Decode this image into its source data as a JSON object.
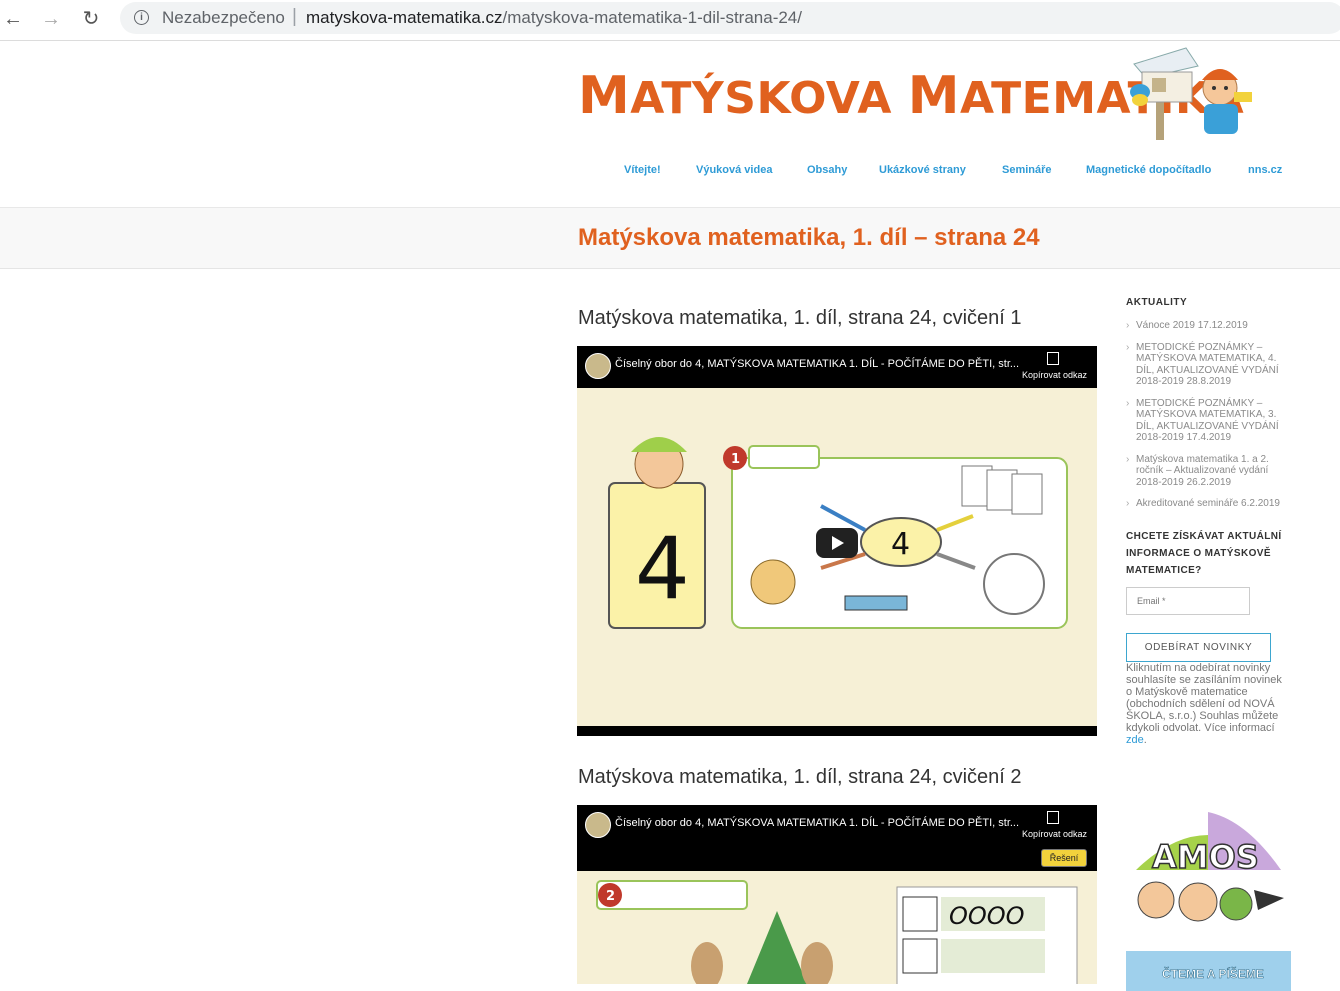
{
  "browser": {
    "insecure_label": "Nezabezpečeno",
    "url_host": "matyskova-matematika.cz",
    "url_path": "/matyskova-matematika-1-dil-strana-24/"
  },
  "site": {
    "logo_text_1_big": "M",
    "logo_text_1_rest": "ATÝSKOVA",
    "logo_text_2_big": "M",
    "logo_text_2_rest": "ATEMATIKA",
    "accent_color": "#e0611f",
    "link_color": "#2e9bd6"
  },
  "nav": {
    "items": [
      {
        "label": "Vítejte!"
      },
      {
        "label": "Výuková videa"
      },
      {
        "label": "Obsahy"
      },
      {
        "label": "Ukázkové strany"
      },
      {
        "label": "Semináře"
      },
      {
        "label": "Magnetické dopočítadlo"
      },
      {
        "label": "nns.cz"
      }
    ]
  },
  "page": {
    "title": "Matýskova matematika, 1. díl – strana 24"
  },
  "exercises": [
    {
      "heading": "Matýskova matematika, 1. díl, strana 24, cvičení 1",
      "video_title": "Číselný obor do 4, MATÝSKOVA MATEMATIKA 1. DÍL - POČÍTÁME DO PĚTI, str...",
      "copy_label": "Kopírovat odkaz",
      "big_number": "4",
      "badge": "1",
      "center_number": "4"
    },
    {
      "heading": "Matýskova matematika, 1. díl, strana 24, cvičení 2",
      "video_title": "Číselný obor do 4, MATÝSKOVA MATEMATIKA 1. DÍL - POČÍTÁME DO PĚTI, str...",
      "copy_label": "Kopírovat odkaz",
      "solution_label": "Řešení",
      "badge": "2",
      "writing": "OOOO"
    }
  ],
  "sidebar": {
    "news_heading": "AKTUALITY",
    "news": [
      {
        "text": "Vánoce 2019 17.12.2019"
      },
      {
        "text": "METODICKÉ POZNÁMKY – MATÝSKOVA MATEMATIKA, 4. DÍL, AKTUALIZOVANÉ VYDÁNÍ 2018-2019 28.8.2019"
      },
      {
        "text": "METODICKÉ POZNÁMKY – MATÝSKOVA MATEMATIKA, 3. DÍL, AKTUALIZOVANÉ VYDÁNÍ 2018-2019 17.4.2019"
      },
      {
        "text": "Matýskova matematika 1. a 2. ročník – Aktualizované vydání 2018-2019 26.2.2019"
      },
      {
        "text": "Akreditované semináře 6.2.2019"
      }
    ],
    "subscribe_heading": "CHCETE ZÍSKÁVAT AKTUÁLNÍ INFORMACE O MATÝSKOVĚ MATEMATICE?",
    "email_placeholder": "Email *",
    "subscribe_button": "ODEBÍRAT NOVINKY",
    "consent_text": "Kliknutím na odebírat novinky souhlasíte se zasíláním novinek o Matýskově matematice (obchodních sdělení od NOVÁ ŠKOLA, s.r.o.) Souhlas můžete kdykoli odvolat. Více informací ",
    "consent_link": "zde",
    "consent_end": ".",
    "amos_text": "AMOS",
    "cteme_text": "ČTEME A PÍŠEME"
  }
}
